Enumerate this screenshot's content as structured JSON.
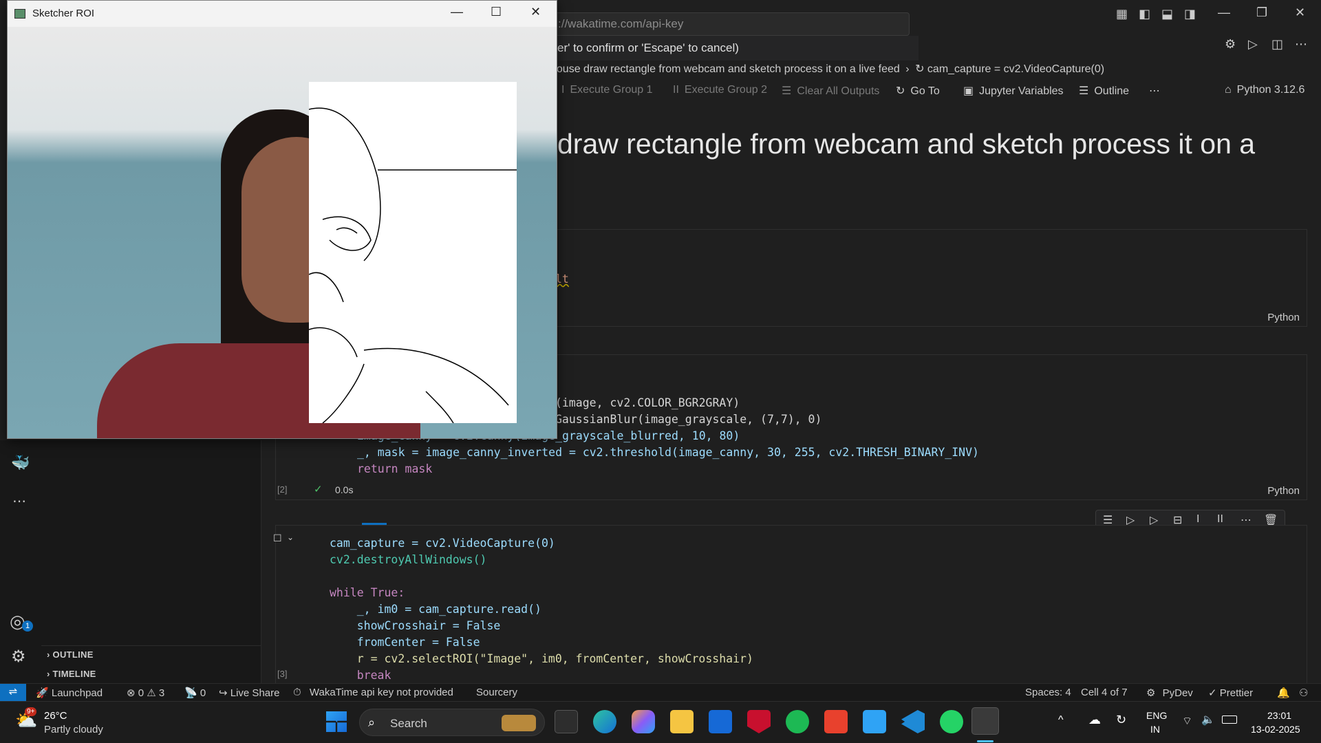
{
  "vscode": {
    "command_input": "://wakatime.com/api-key",
    "command_hint": "er' to confirm or 'Escape' to cancel)",
    "breadcrumb": {
      "part1": "house draw rectangle from webcam and sketch process it on a live feed",
      "part2": "cam_capture = cv2.VideoCapture(0)"
    },
    "toolbar": {
      "execute_group_1": "Execute Group 1",
      "execute_group_2": "Execute Group 2",
      "clear_all_outputs": "Clear All Outputs",
      "go_to": "Go To",
      "jupyter_variables": "Jupyter Variables",
      "outline": "Outline",
      "kernel": "Python 3.12.6"
    },
    "heading": "draw rectangle from webcam and sketch process it on a",
    "cell1": {
      "code_fragment": "lt",
      "lang": "Python"
    },
    "cell2": {
      "lines": [
        "(image, cv2.COLOR_BGR2GRAY)",
        "GaussianBlur(image_grayscale, (7,7), 0)",
        "image_canny = cv2.Canny(image_grayscale_blurred, 10, 80)",
        "_, mask = image_canny_inverted = cv2.threshold(image_canny, 30, 255, cv2.THRESH_BINARY_INV)",
        "return mask"
      ],
      "exec_count": "[2]",
      "duration": "0.0s",
      "lang": "Python"
    },
    "cell3": {
      "lines": [
        "cam_capture = cv2.VideoCapture(0)",
        "cv2.destroyAllWindows()",
        "",
        "while True:",
        "    _, im0 = cam_capture.read()",
        "    showCrosshair = False",
        "    fromCenter = False",
        "    r = cv2.selectROI(\"Image\", im0, fromCenter, showCrosshair)",
        "    break"
      ],
      "exec_count": "[3]"
    },
    "sidebar": {
      "outline": "OUTLINE",
      "timeline": "TIMELINE"
    },
    "accounts_badge": "1",
    "statusbar": {
      "launchpad": "Launchpad",
      "errors": "0",
      "warnings": "3",
      "ports": "0",
      "live_share": "Live Share",
      "wakatime": "WakaTime api key not provided",
      "sourcery": "Sourcery",
      "spaces": "Spaces: 4",
      "cell": "Cell 4 of 7",
      "pydev": "PyDev",
      "prettier": "Prettier"
    }
  },
  "sketcher": {
    "title": "Sketcher ROI"
  },
  "taskbar": {
    "weather_temp": "26°C",
    "weather_desc": "Partly cloudy",
    "weather_badge": "9+",
    "search_placeholder": "Search",
    "lang_top": "ENG",
    "lang_bottom": "IN",
    "time": "23:01",
    "date": "13-02-2025"
  }
}
